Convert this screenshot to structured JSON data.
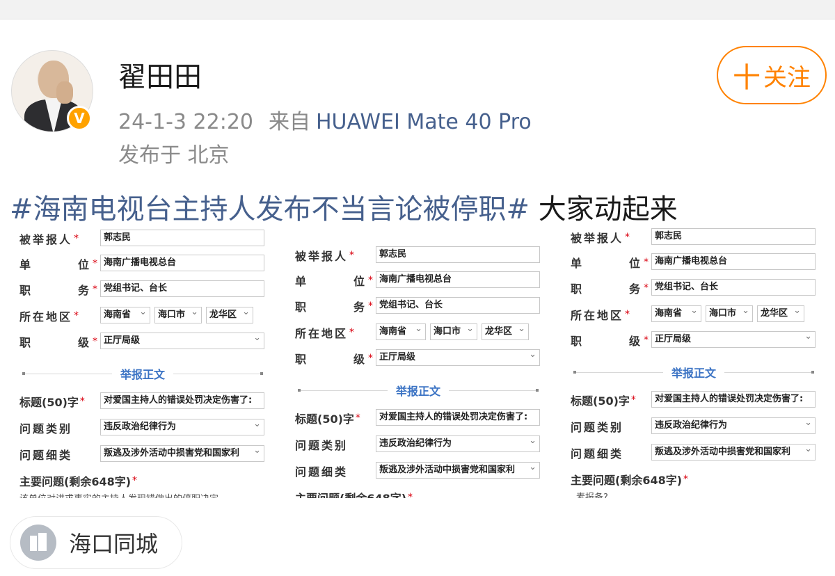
{
  "post": {
    "username": "翟田田",
    "timestamp": "24-1-3 22:20",
    "from_label": "来自",
    "device": "HUAWEI Mate 40 Pro",
    "location": "发布于 北京",
    "follow_label": "关注",
    "follow_plus": "十",
    "verified_mark": "V",
    "topic": "#海南电视台主持人发布不当言论被停职#",
    "text": " 大家动起来",
    "geo_tag": "海口同城"
  },
  "form": {
    "labels": {
      "reported_person": "被举报人",
      "unit_left": "单",
      "unit_right": "位",
      "duty_left": "职",
      "duty_right": "务",
      "region": "所在地区",
      "level_left": "职",
      "level_right": "级",
      "section": "举报正文",
      "title": "标题(50)字",
      "problem_type": "问题类别",
      "problem_detail": "问题细类",
      "main_issue": "主要问题(剩余648字)",
      "required": "*"
    },
    "values": {
      "reported_person": "郭志民",
      "unit": "海南广播电视总台",
      "duty": "党组书记、台长",
      "province": "海南省",
      "city": "海口市",
      "district": "龙华区",
      "level": "正厅局级",
      "title": "对爱国主持人的错误处罚决定伤害了:",
      "problem_type": "违反政治纪律行为",
      "problem_detail": "叛逃及涉外活动中损害党和国家利"
    },
    "snippets": {
      "left": "该单位对讲求事实的主持人发现错做出的停职决定",
      "right": "素报备?"
    }
  },
  "colors": {
    "accent": "#ff8200",
    "link": "#46608d",
    "required": "#d9000f",
    "section": "#3b73c4"
  }
}
